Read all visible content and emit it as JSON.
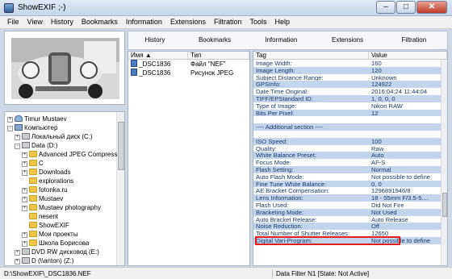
{
  "window": {
    "title": "ShowEXIF ;-)"
  },
  "menu": [
    "File",
    "View",
    "History",
    "Bookmarks",
    "Information",
    "Extensions",
    "Filtration",
    "Tools",
    "Help"
  ],
  "toolbar": [
    "History",
    "Bookmarks",
    "Information",
    "Extensions",
    "Filtration"
  ],
  "tree": [
    {
      "label": "Timur Mustaev",
      "icon": "user",
      "indent": 0,
      "exp": "+"
    },
    {
      "label": "Компьютер",
      "icon": "pc",
      "indent": 0,
      "exp": "-"
    },
    {
      "label": "Локальный диск (C:)",
      "icon": "drive",
      "indent": 1,
      "exp": "+"
    },
    {
      "label": "Data (D:)",
      "icon": "drive",
      "indent": 1,
      "exp": "-"
    },
    {
      "label": "Advanced JPEG Compress",
      "icon": "fold",
      "indent": 2,
      "exp": "+"
    },
    {
      "label": "C",
      "icon": "fold",
      "indent": 2,
      "exp": "+"
    },
    {
      "label": "Downloads",
      "icon": "fold",
      "indent": 2,
      "exp": "+"
    },
    {
      "label": "explorations",
      "icon": "fold",
      "indent": 2,
      "exp": ""
    },
    {
      "label": "fotonka.ru",
      "icon": "fold",
      "indent": 2,
      "exp": "+"
    },
    {
      "label": "Mustaev",
      "icon": "fold",
      "indent": 2,
      "exp": "+"
    },
    {
      "label": "Mustaev photography",
      "icon": "fold",
      "indent": 2,
      "exp": "+"
    },
    {
      "label": "nesent",
      "icon": "fold",
      "indent": 2,
      "exp": ""
    },
    {
      "label": "ShowEXIF",
      "icon": "fold",
      "indent": 2,
      "exp": ""
    },
    {
      "label": "Мои проекты",
      "icon": "fold",
      "indent": 2,
      "exp": "+"
    },
    {
      "label": "Школа Борисова",
      "icon": "fold",
      "indent": 2,
      "exp": "+"
    },
    {
      "label": "DVD RW дисковод (E:)",
      "icon": "drive",
      "indent": 1,
      "exp": "+"
    },
    {
      "label": "D (\\\\anton) (Z:)",
      "icon": "drive",
      "indent": 1,
      "exp": "+"
    }
  ],
  "files": {
    "headers": [
      "Имя",
      "Тип"
    ],
    "rows": [
      {
        "name": "_DSC1836",
        "type": "Файл \"NEF\""
      },
      {
        "name": "_DSC1836",
        "type": "Рисунок JPEG"
      }
    ]
  },
  "tags": {
    "headers": [
      "Tag",
      "Value"
    ],
    "rows": [
      {
        "k": "Image Width:",
        "v": "160"
      },
      {
        "k": "Image Length:",
        "v": "120"
      },
      {
        "k": "Subject Distance Range:",
        "v": "Unknown"
      },
      {
        "k": "GPSInfo:",
        "v": "124922"
      },
      {
        "k": "Date Time Original:",
        "v": "2016:04:24 11:44:04"
      },
      {
        "k": "TIFF/EPStandard ID:",
        "v": "1, 0, 0, 0"
      },
      {
        "k": "Type of Image:",
        "v": "Nikon RAW"
      },
      {
        "k": "Bits Per Pixel:",
        "v": "12"
      },
      {
        "k": "",
        "v": ""
      },
      {
        "k": "---- Additional section ----",
        "v": ""
      },
      {
        "k": "",
        "v": ""
      },
      {
        "k": "ISO Speed:",
        "v": "100"
      },
      {
        "k": "Quality:",
        "v": "Raw"
      },
      {
        "k": "White Balance Preset:",
        "v": "Auto"
      },
      {
        "k": "Focus Mode:",
        "v": "AF-S"
      },
      {
        "k": "Flash Setting:",
        "v": "Normal"
      },
      {
        "k": "Auto Flash Mode:",
        "v": "Not possible to define"
      },
      {
        "k": "Fine Tune White Balance:",
        "v": "0, 0"
      },
      {
        "k": "AE Bracket Compensation:",
        "v": "1296891946/8"
      },
      {
        "k": "Lens Information:",
        "v": "18 - 55mm F/3.5-5...."
      },
      {
        "k": "Flash Used:",
        "v": "Did Not Fire"
      },
      {
        "k": "Bracketing Mode:",
        "v": "Not Used"
      },
      {
        "k": "Auto Bracket Release:",
        "v": "Auto Release"
      },
      {
        "k": "Noise Reduction:",
        "v": "Off"
      },
      {
        "k": "Total Number of Shutter Releases:",
        "v": "12650"
      },
      {
        "k": "Digital Vari-Program:",
        "v": "Not possible to define"
      },
      {
        "k": "",
        "v": ""
      }
    ]
  },
  "status": {
    "path": "D:\\ShowEXIF\\_DSC1836.NEF",
    "filter": "Data Filter N1 [State: Not Active]"
  }
}
